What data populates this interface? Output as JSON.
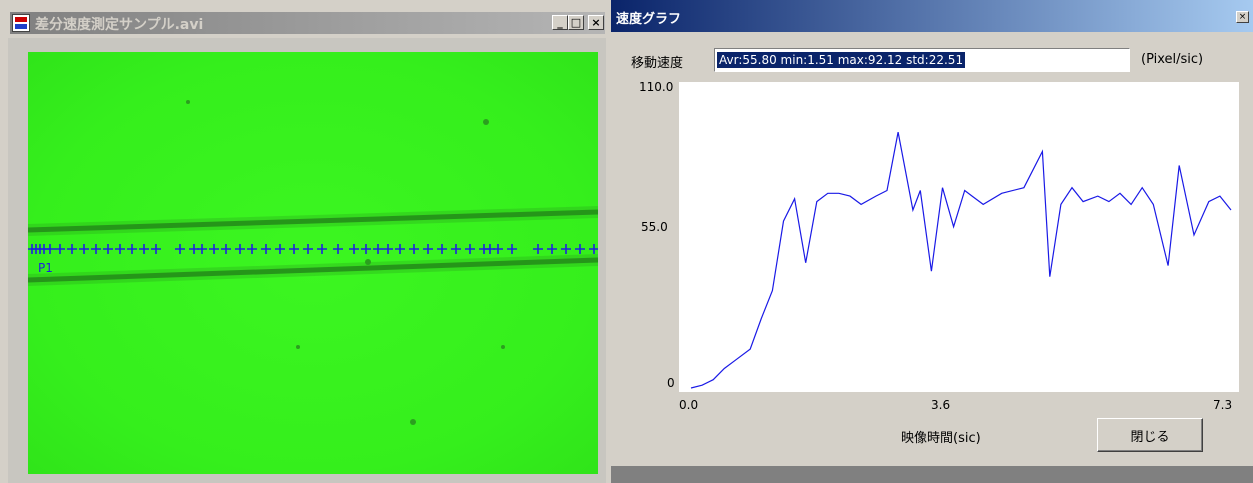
{
  "video_window": {
    "title": "差分速度測定サンプル.avi",
    "buttons": {
      "minimize": "_",
      "maximize": "□",
      "close": "×"
    },
    "track_label": "P1",
    "colors": {
      "background": "#3cf621",
      "marker": "#2020e0",
      "line": "#1f7a18"
    }
  },
  "graph_window": {
    "title": "速度グラフ",
    "close_button": "×",
    "speed_label": "移動速度",
    "speed_value": "Avr:55.80 min:1.51 max:92.12 std:22.51",
    "speed_unit": "(Pixel/sic)",
    "x_axis_label": "映像時間(sic)",
    "close_graph_button": "閉じる"
  },
  "chart_data": {
    "type": "line",
    "xlabel": "映像時間(sic)",
    "ylabel": "",
    "xlim": [
      0,
      7.3
    ],
    "ylim": [
      0,
      110
    ],
    "x_tick_labels": [
      "0.0",
      "3.6",
      "7.3"
    ],
    "y_tick_labels": [
      "110.0",
      "55.0",
      "0"
    ],
    "line_color": "#1a1ae6",
    "series": [
      {
        "x": [
          0,
          0.15,
          0.3,
          0.45,
          0.6,
          0.8,
          0.95,
          1.1,
          1.25,
          1.4,
          1.55,
          1.7,
          1.85,
          2.0,
          2.15,
          2.3,
          2.5,
          2.65,
          2.8,
          3.0,
          3.1,
          3.25,
          3.4,
          3.55,
          3.7,
          3.8,
          3.95,
          4.2,
          4.5,
          4.75,
          4.85,
          5.0,
          5.15,
          5.3,
          5.5,
          5.65,
          5.8,
          5.95,
          6.1,
          6.25,
          6.45,
          6.6,
          6.8,
          7.0,
          7.15,
          7.3
        ],
        "y": [
          0,
          1,
          3,
          7,
          10,
          14,
          25,
          35,
          60,
          68,
          45,
          67,
          70,
          70,
          69,
          66,
          69,
          71,
          92,
          64,
          71,
          42,
          72,
          58,
          71,
          69,
          66,
          70,
          72,
          85,
          40,
          66,
          72,
          67,
          69,
          67,
          70,
          66,
          72,
          66,
          44,
          80,
          55,
          67,
          69,
          64
        ]
      }
    ]
  }
}
